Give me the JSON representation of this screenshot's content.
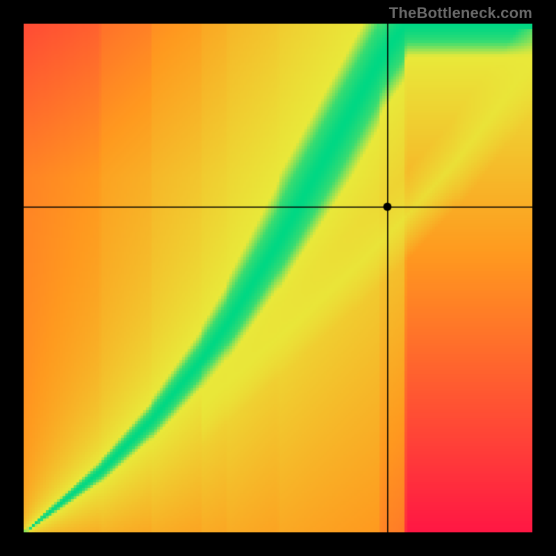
{
  "watermark": "TheBottleneck.com",
  "chart_data": {
    "type": "heatmap",
    "title": "",
    "xlabel": "",
    "ylabel": "",
    "xlim": [
      0,
      1
    ],
    "ylim": [
      0,
      1
    ],
    "crosshair": {
      "x": 0.715,
      "y": 0.64
    },
    "marker": {
      "x": 0.715,
      "y": 0.64
    },
    "optimal_curve": {
      "description": "Ridge of the green optimal band; value axis is vertical (0 bottom → 1 top) as a function of horizontal position (0 left → 1 right).",
      "x": [
        0.0,
        0.05,
        0.1,
        0.15,
        0.2,
        0.25,
        0.3,
        0.35,
        0.4,
        0.45,
        0.5,
        0.55,
        0.6,
        0.65,
        0.7,
        0.75,
        0.8
      ],
      "y": [
        0.0,
        0.04,
        0.08,
        0.12,
        0.17,
        0.22,
        0.28,
        0.34,
        0.41,
        0.49,
        0.57,
        0.66,
        0.75,
        0.84,
        0.93,
        1.0,
        1.0
      ]
    },
    "optimal_band_halfwidth": 0.04,
    "secondary_ridge": {
      "description": "Faint yellow diagonal ridge (upper-right), y as function of x.",
      "x": [
        0.55,
        0.65,
        0.75,
        0.85,
        0.95,
        1.0
      ],
      "y": [
        0.43,
        0.52,
        0.62,
        0.73,
        0.86,
        0.93
      ]
    },
    "color_stops": {
      "optimal": "#00d884",
      "near": "#e9e93a",
      "mid": "#ff9a1f",
      "far": "#ff1744"
    }
  }
}
